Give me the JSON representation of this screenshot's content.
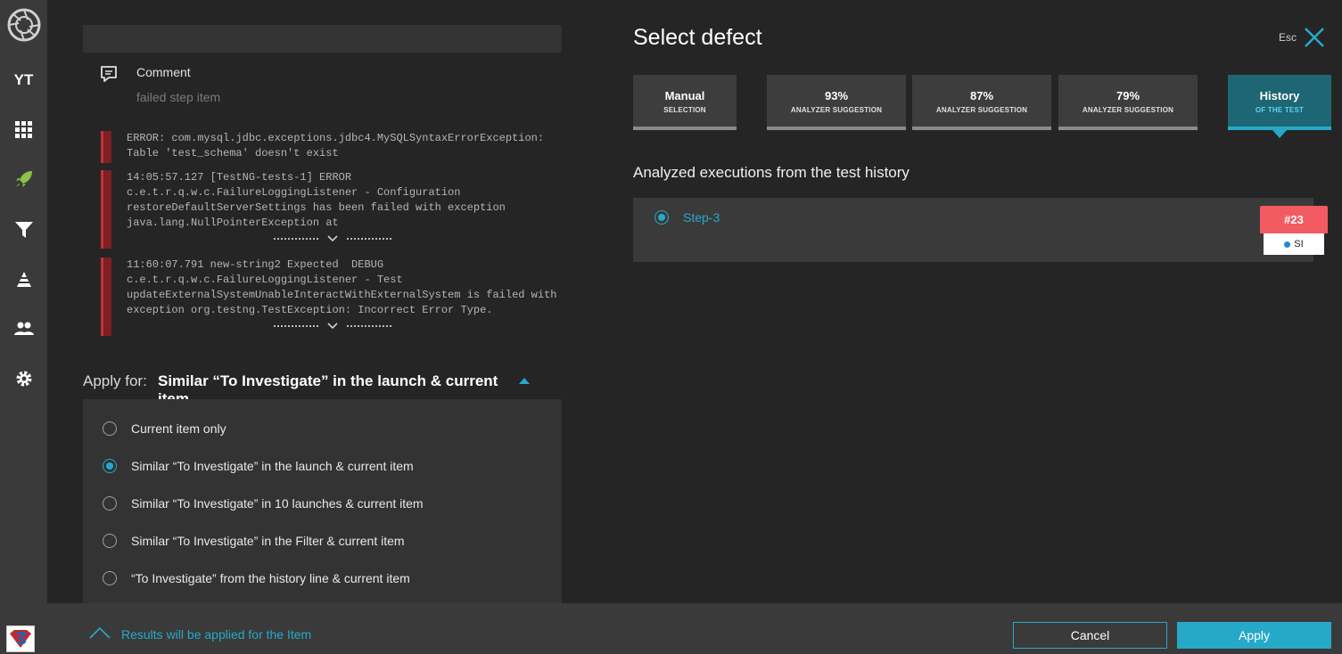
{
  "sidebar": {
    "items": [
      {
        "icon": "logo-icon"
      },
      {
        "label": "YT"
      },
      {
        "icon": "dashboard-grid-icon"
      },
      {
        "icon": "rocket-icon"
      },
      {
        "icon": "filter-icon"
      },
      {
        "icon": "debug-icon"
      },
      {
        "icon": "users-icon"
      },
      {
        "icon": "gear-icon"
      }
    ],
    "active_color": "#8bc34a"
  },
  "left_panel": {
    "comment": {
      "title": "Comment",
      "placeholder": "failed step item"
    },
    "logs": [
      {
        "text": "ERROR: com.mysql.jdbc.exceptions.jdbc4.MySQLSyntaxErrorException:\nTable 'test_schema' doesn't exist"
      },
      {
        "text": "14:05:57.127 [TestNG-tests-1] ERROR\nc.e.t.r.q.w.c.FailureLoggingListener - Configuration\nrestoreDefaultServerSettings has been failed with exception\njava.lang.NullPointerException at"
      },
      {
        "text": "11:60:07.791 new-string2 Expected  DEBUG\nc.e.t.r.q.w.c.FailureLoggingListener - Test\nupdateExternalSystemUnableInteractWithExternalSystem is failed with\nexception org.testng.TestException: Incorrect Error Type."
      }
    ],
    "apply_for": {
      "label": "Apply for:",
      "selected": "Similar “To Investigate” in the launch & current item",
      "options": [
        {
          "label": "Current item only",
          "checked": false
        },
        {
          "label": "Similar “To Investigate” in the launch & current item",
          "checked": true
        },
        {
          "label": "Similar “To Investigate” in 10 launches & current item",
          "checked": false
        },
        {
          "label": "Similar “To Investigate” in the Filter & current item",
          "checked": false
        },
        {
          "label": "“To Investigate” from the history line & current item",
          "checked": false
        }
      ]
    }
  },
  "modal": {
    "title": "Select defect",
    "esc_label": "Esc",
    "tabs": [
      {
        "big": "Manual",
        "small": "SELECTION",
        "active": false
      },
      {
        "big": "93%",
        "small": "ANALYZER SUGGESTION",
        "active": false
      },
      {
        "big": "87%",
        "small": "ANALYZER SUGGESTION",
        "active": false
      },
      {
        "big": "79%",
        "small": "ANALYZER SUGGESTION",
        "active": false
      },
      {
        "big": "History",
        "small": "OF THE TEST",
        "active": true
      }
    ],
    "history_section": {
      "title": "Analyzed executions from the test history",
      "item": {
        "label": "Step-3",
        "checked": true,
        "badge": "#23",
        "badge_sub": "SI"
      }
    }
  },
  "footer": {
    "note": "Results will be applied for the Item",
    "cancel_label": "Cancel",
    "apply_label": "Apply"
  },
  "colors": {
    "accent": "#26a9c9",
    "error_bar": "#c73034",
    "badge": "#f15b61"
  }
}
